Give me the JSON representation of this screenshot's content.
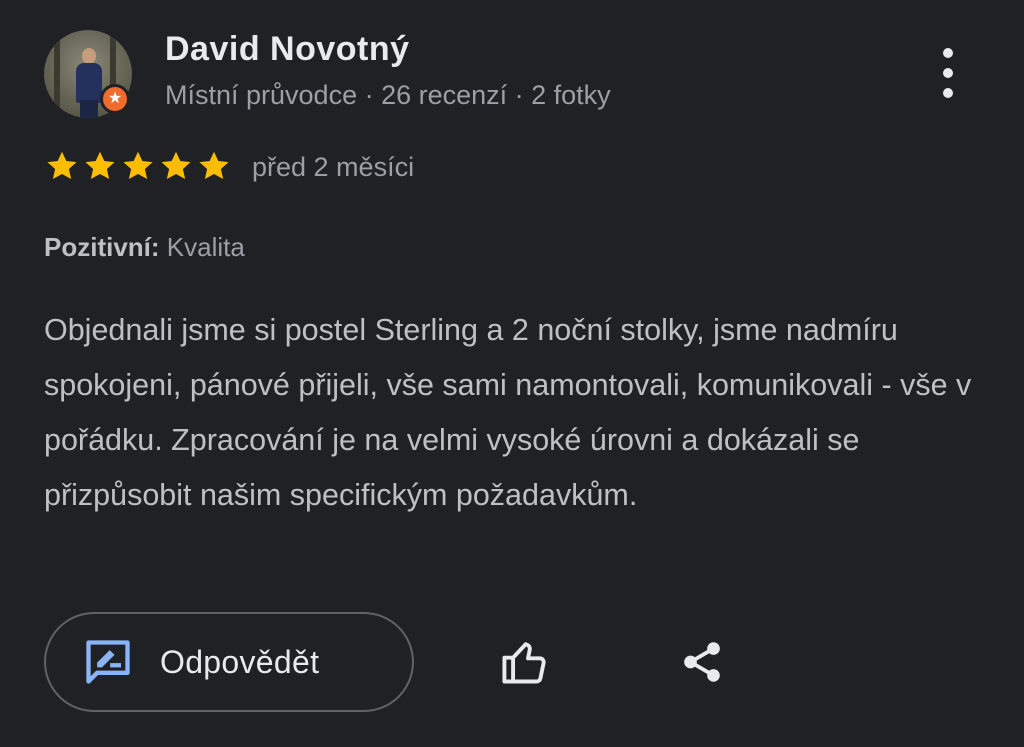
{
  "reviewer": {
    "name": "David Novotný",
    "meta": "Místní průvodce · 26 recenzí · 2 fotky",
    "avatar_icon": "person-photo",
    "badge_icon": "local-guide-star-icon",
    "badge_color": "#ef6c2d"
  },
  "rating": {
    "stars": 5,
    "max": 5,
    "star_color": "#fbbc04",
    "date": "před 2 měsíci"
  },
  "attributes": {
    "label": "Pozitivní:",
    "value": "Kvalita"
  },
  "review_text": "Objednali jsme si postel Sterling a 2 noční stolky, jsme nadmíru spokojeni, pánové přijeli, vše sami namontovali, komunikovali - vše v pořádku. Zpracování je na velmi vysoké úrovni a dokázali se přizpůsobit našim specifickým požadavkům.",
  "actions": {
    "reply_label": "Odpovědět",
    "reply_icon": "rate-review-icon",
    "like_icon": "thumb-up-icon",
    "share_icon": "share-icon",
    "more_icon": "more-vert-icon",
    "accent_color": "#8ab4f8"
  }
}
